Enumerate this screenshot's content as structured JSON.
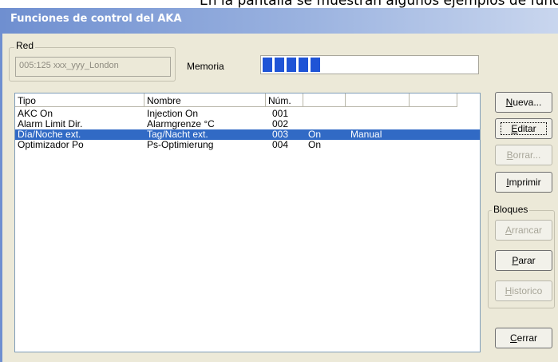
{
  "caption_above": "En la pantalla se muestran algunos ejemplos de funciones de control",
  "window": {
    "title": "Funciones de control del AKA"
  },
  "network_group": {
    "label": "Red",
    "value": "005:125  xxx_yyy_London"
  },
  "memory": {
    "label": "Memoria",
    "level": 0.28
  },
  "list": {
    "columns": [
      "Tipo",
      "Nombre",
      "Núm.",
      "",
      "",
      ""
    ],
    "rows": [
      {
        "tipo": "AKC On",
        "nombre": "Injection On",
        "num": "001",
        "estado": "",
        "modo": "",
        "selected": false
      },
      {
        "tipo": "Alarm Limit Dir.",
        "nombre": "Alarmgrenze °C",
        "num": "002",
        "estado": "",
        "modo": "",
        "selected": false
      },
      {
        "tipo": "Día/Noche ext.",
        "nombre": "Tag/Nacht ext.",
        "num": "003",
        "estado": "On",
        "modo": "Manual",
        "selected": true
      },
      {
        "tipo": "Optimizador Po",
        "nombre": "Ps-Optimierung",
        "num": "004",
        "estado": "On",
        "modo": "",
        "selected": false
      }
    ]
  },
  "buttons": {
    "nueva": {
      "mnemonic": "N",
      "rest": "ueva..."
    },
    "editar": {
      "mnemonic": "E",
      "rest": "ditar"
    },
    "borrar": {
      "mnemonic": "B",
      "rest": "orrar..."
    },
    "imprimir": {
      "mnemonic": "I",
      "rest": "mprimir"
    },
    "arrancar": {
      "mnemonic": "A",
      "rest": "rrancar"
    },
    "parar": {
      "mnemonic": "P",
      "rest": "arar"
    },
    "historico": {
      "mnemonic": "H",
      "rest": "istorico"
    },
    "cerrar": {
      "mnemonic": "C",
      "rest": "errar"
    }
  },
  "blocks_group": {
    "label": "Bloques"
  },
  "colors": {
    "title_bar": "#6f8fd0",
    "selection": "#316ac5",
    "meter": "#1f54d6",
    "dialog_bg": "#ece9d8"
  }
}
